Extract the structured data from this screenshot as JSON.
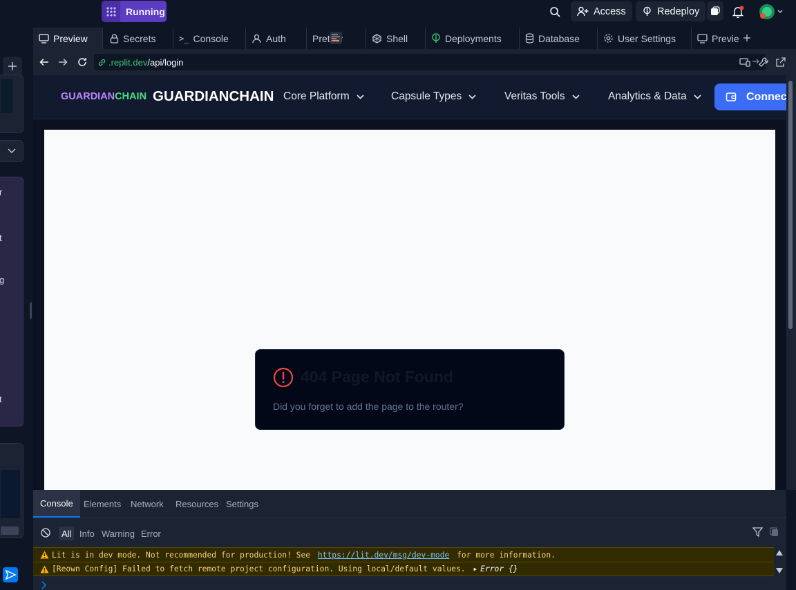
{
  "topbar": {
    "run_status": "Running",
    "access_label": "Access",
    "redeploy_label": "Redeploy"
  },
  "tabs": [
    {
      "label": "Preview",
      "icon": "monitor-icon",
      "active": true
    },
    {
      "label": "Secrets",
      "icon": "lock-icon"
    },
    {
      "label": "Console",
      "icon": "terminal-icon"
    },
    {
      "label": "Auth",
      "icon": "user-icon"
    },
    {
      "label": "Prettier",
      "icon": "prettier-icon"
    },
    {
      "label": "Shell",
      "icon": "shell-icon"
    },
    {
      "label": "Deployments",
      "icon": "deploy-icon"
    },
    {
      "label": "Database",
      "icon": "database-icon"
    },
    {
      "label": "User Settings",
      "icon": "gear-icon"
    },
    {
      "label": "Previe",
      "icon": "monitor-icon"
    }
  ],
  "urlbar": {
    "host": ".replit.dev",
    "path": "/api/login"
  },
  "app": {
    "logo_part1": "GUARDIAN",
    "logo_part2": "CHAIN",
    "brand": "GUARDIANCHAIN",
    "nav": [
      "Core Platform",
      "Capsule Types",
      "Veritas Tools",
      "Analytics & Data"
    ],
    "connect_label": "Connect"
  },
  "error_card": {
    "title": "404 Page Not Found",
    "message": "Did you forget to add the page to the router?"
  },
  "sidebar_fragments": [
    "r",
    "t",
    "g",
    "t"
  ],
  "devtools": {
    "tabs": [
      "Console",
      "Elements",
      "Network",
      "Resources",
      "Settings"
    ],
    "filters": [
      "All",
      "Info",
      "Warning",
      "Error"
    ],
    "messages": [
      {
        "pre": "Lit is in dev mode. Not recommended for production! See ",
        "link": "https://lit.dev/msg/dev-mode",
        "post": " for more information."
      },
      {
        "pre": "[Reown Config] Failed to fetch remote project configuration. Using local/default values. ",
        "expand": "▸",
        "detail": "Error {}"
      }
    ]
  },
  "colors": {
    "accent_purple": "#5a3dc0",
    "connect_blue": "#3b6cf6",
    "error_red": "#ef4444",
    "logo_purple": "#c084fc",
    "logo_green": "#4ade80"
  }
}
